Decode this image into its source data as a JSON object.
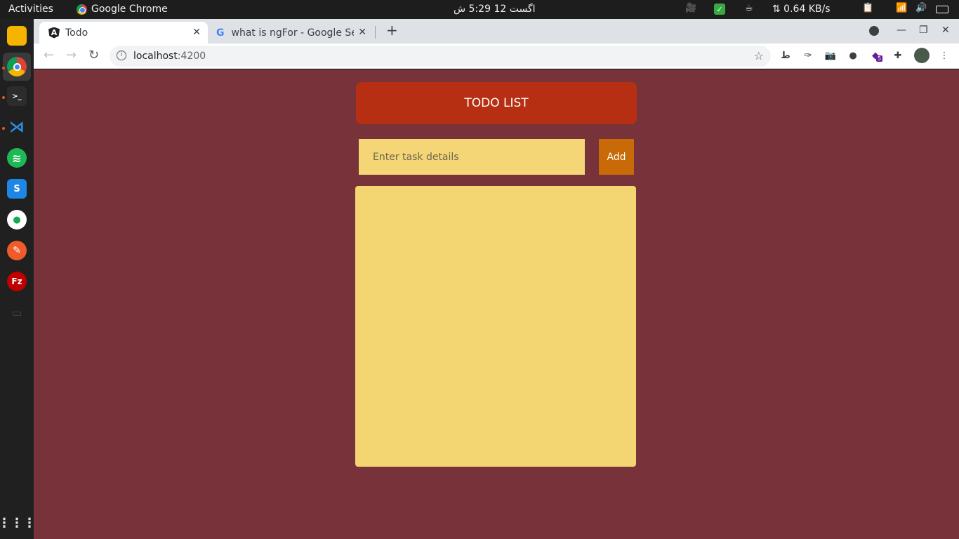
{
  "system": {
    "activities": "Activities",
    "app_name": "Google Chrome",
    "clock": "اگست 12  5:29 ش",
    "net_speed": "⇅ 0.64 KB/s"
  },
  "browser": {
    "tabs": [
      {
        "title": "Todo",
        "active": true
      },
      {
        "title": "what is ngFor - Google Sea",
        "active": false
      }
    ],
    "new_tab": "+",
    "url_host": "localhost",
    "url_port": ":4200",
    "extension_badge": "5"
  },
  "app": {
    "title": "TODO LIST",
    "input_placeholder": "Enter task details",
    "input_value": "",
    "add_label": "Add"
  },
  "colors": {
    "page_bg": "#78333a",
    "header_bg": "#b72f12",
    "input_bg": "#f4d676",
    "add_bg": "#c76a07",
    "list_bg": "#f3d672"
  }
}
